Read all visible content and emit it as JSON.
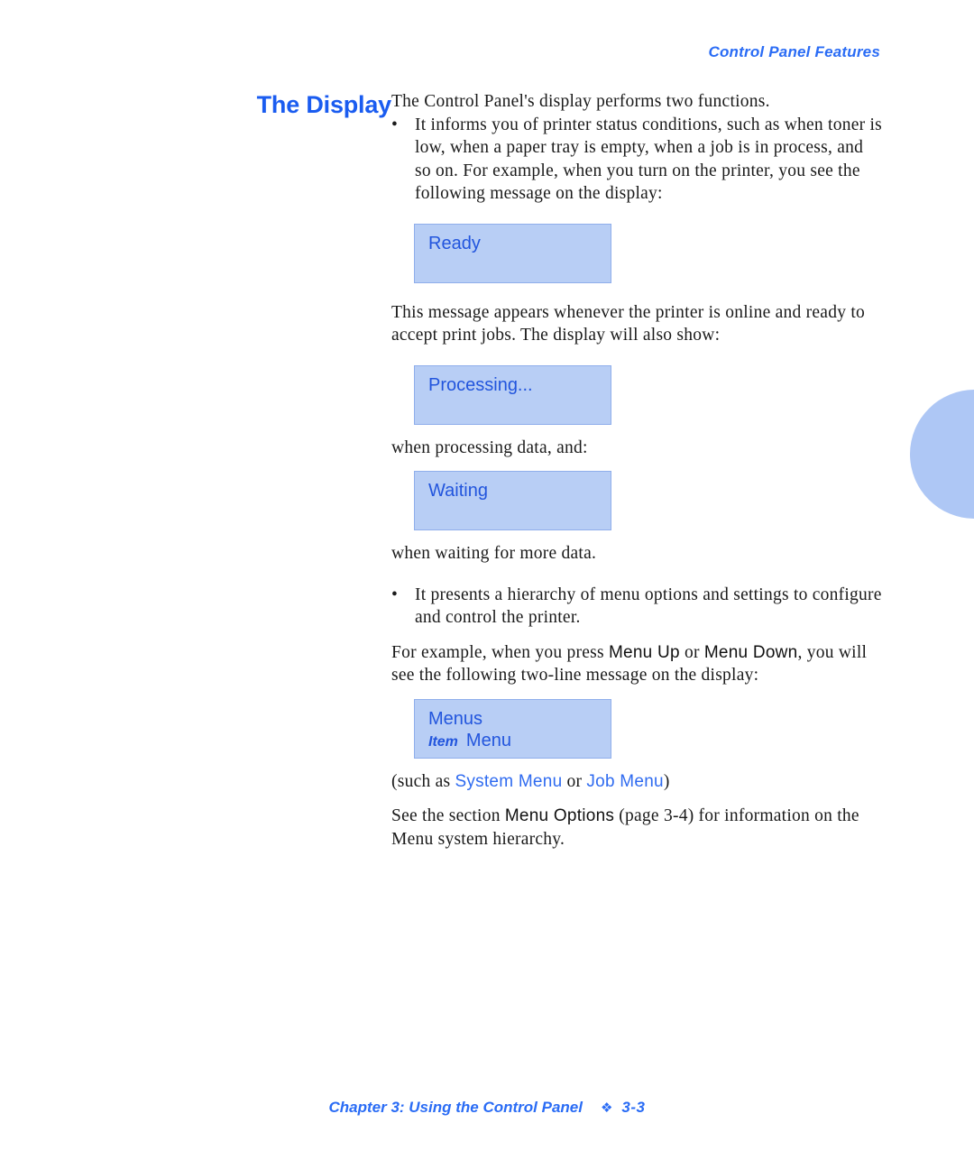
{
  "header": {
    "running_head": "Control Panel Features"
  },
  "section": {
    "title": "The Display"
  },
  "body": {
    "intro": "The Control Panel's display performs two functions.",
    "bullet_marker": "•",
    "bullet_1": "It informs you of printer status conditions, such as when toner is low, when a paper tray is empty, when a job is in process, and so on. For example, when you turn on the printer, you see the following message on the display:",
    "after_ready": "This message appears whenever the printer is online and ready to accept print jobs. The display will also show:",
    "after_processing": "when processing data, and:",
    "after_waiting": "when waiting for more data.",
    "bullet_2": "It presents a hierarchy of menu options and settings to configure and control the printer.",
    "example_lead": "For example, when you press ",
    "example_key_1": "Menu Up",
    "example_mid": " or ",
    "example_key_2": "Menu Down",
    "example_tail": ", you will see the following two-line message on the display:",
    "such_as_lead": "(such as ",
    "such_as_term_1": "System Menu",
    "such_as_mid": " or ",
    "such_as_term_2": "Job Menu",
    "such_as_tail": ")",
    "see_lead": "See the section ",
    "see_term": "Menu Options",
    "see_tail": " (page 3-4) for information on the Menu system hierarchy."
  },
  "displays": {
    "ready": {
      "line1": "Ready"
    },
    "processing": {
      "line1": "Processing..."
    },
    "waiting": {
      "line1": "Waiting"
    },
    "menus": {
      "line1": "Menus",
      "line2_label": "Item",
      "line2_value": "Menu"
    }
  },
  "footer": {
    "chapter": "Chapter 3: Using the Control Panel",
    "diamond": "❖",
    "page": "3-3"
  },
  "colors": {
    "accent_blue": "#1A5CF0",
    "header_blue": "#2A6CF5",
    "lcd_fill": "#B8CEF5",
    "lcd_text": "#2255DD",
    "side_tab": "#AEC7F5"
  }
}
